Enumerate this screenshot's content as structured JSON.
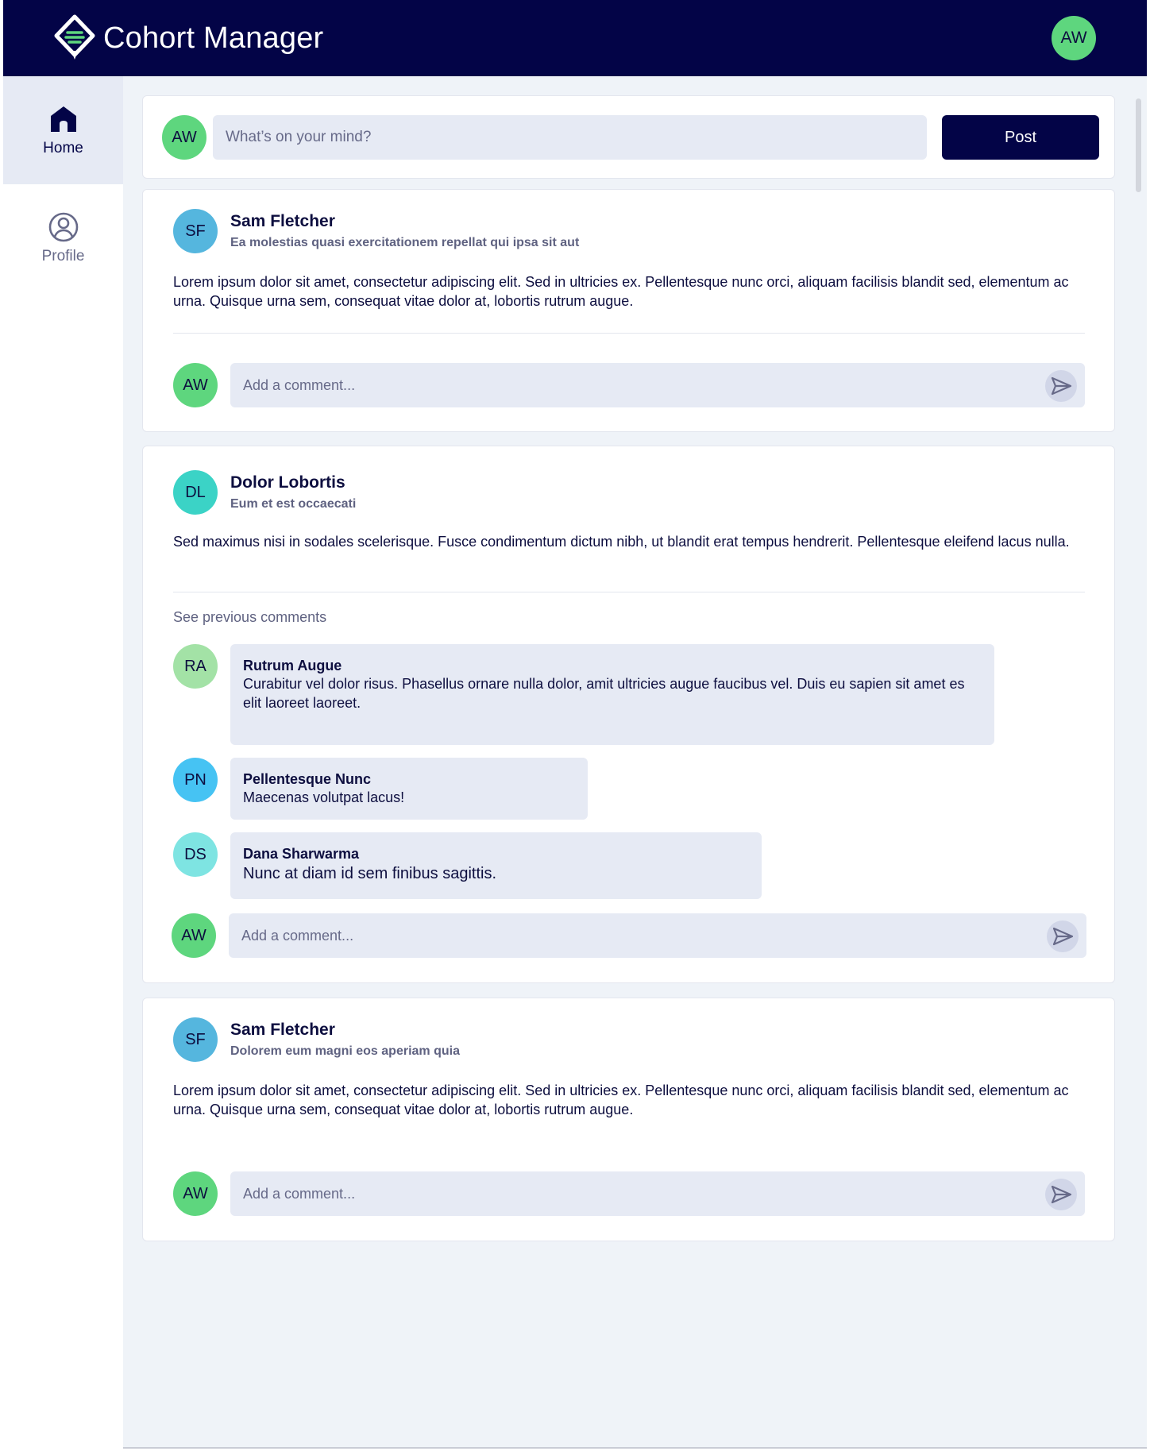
{
  "app": {
    "title": "Cohort Manager",
    "user_initials": "AW"
  },
  "colors": {
    "brand_navy": "#030447",
    "accent_green": "#5ed67e",
    "input_bg": "#e6eaf4"
  },
  "sidebar": {
    "items": [
      {
        "label": "Home",
        "icon": "home-icon",
        "active": true
      },
      {
        "label": "Profile",
        "icon": "profile-icon",
        "active": false
      }
    ]
  },
  "composer": {
    "avatar": "AW",
    "placeholder": "What’s on your mind?",
    "post_label": "Post"
  },
  "posts": [
    {
      "author_initials": "SF",
      "author_name": "Sam Fletcher",
      "subtitle": "Ea molestias quasi exercitationem repellat qui ipsa sit aut",
      "body": "Lorem ipsum dolor sit amet, consectetur adipiscing elit. Sed in ultricies ex. Pellentesque nunc orci, aliquam facilisis blandit sed, elementum ac urna. Quisque urna sem, consequat vitae dolor at, lobortis rutrum augue.",
      "comment_avatar": "AW",
      "comment_placeholder": "Add a comment..."
    },
    {
      "author_initials": "DL",
      "author_name": "Dolor Lobortis",
      "subtitle": "Eum et est occaecati",
      "body": "Sed maximus nisi in sodales scelerisque. Fusce condimentum dictum nibh, ut blandit erat tempus hendrerit. Pellentesque eleifend lacus nulla.",
      "see_previous": "See previous comments",
      "comments": [
        {
          "initials": "RA",
          "name": "Rutrum Augue",
          "text": "Curabitur vel dolor risus. Phasellus ornare nulla dolor, amit ultricies augue faucibus vel. Duis eu sapien sit amet es elit laoreet laoreet."
        },
        {
          "initials": "PN",
          "name": "Pellentesque Nunc",
          "text": "Maecenas volutpat lacus!"
        },
        {
          "initials": "DS",
          "name": "Dana Sharwarma",
          "text": "Nunc at diam id sem finibus sagittis."
        }
      ],
      "comment_avatar": "AW",
      "comment_placeholder": "Add a comment..."
    },
    {
      "author_initials": "SF",
      "author_name": "Sam Fletcher",
      "subtitle": "Dolorem eum magni eos aperiam quia",
      "body": "Lorem ipsum dolor sit amet, consectetur adipiscing elit. Sed in ultricies ex. Pellentesque nunc orci, aliquam facilisis blandit sed, elementum ac urna. Quisque urna sem, consequat vitae dolor at, lobortis rutrum augue.",
      "comment_avatar": "AW",
      "comment_placeholder": "Add a comment..."
    }
  ]
}
